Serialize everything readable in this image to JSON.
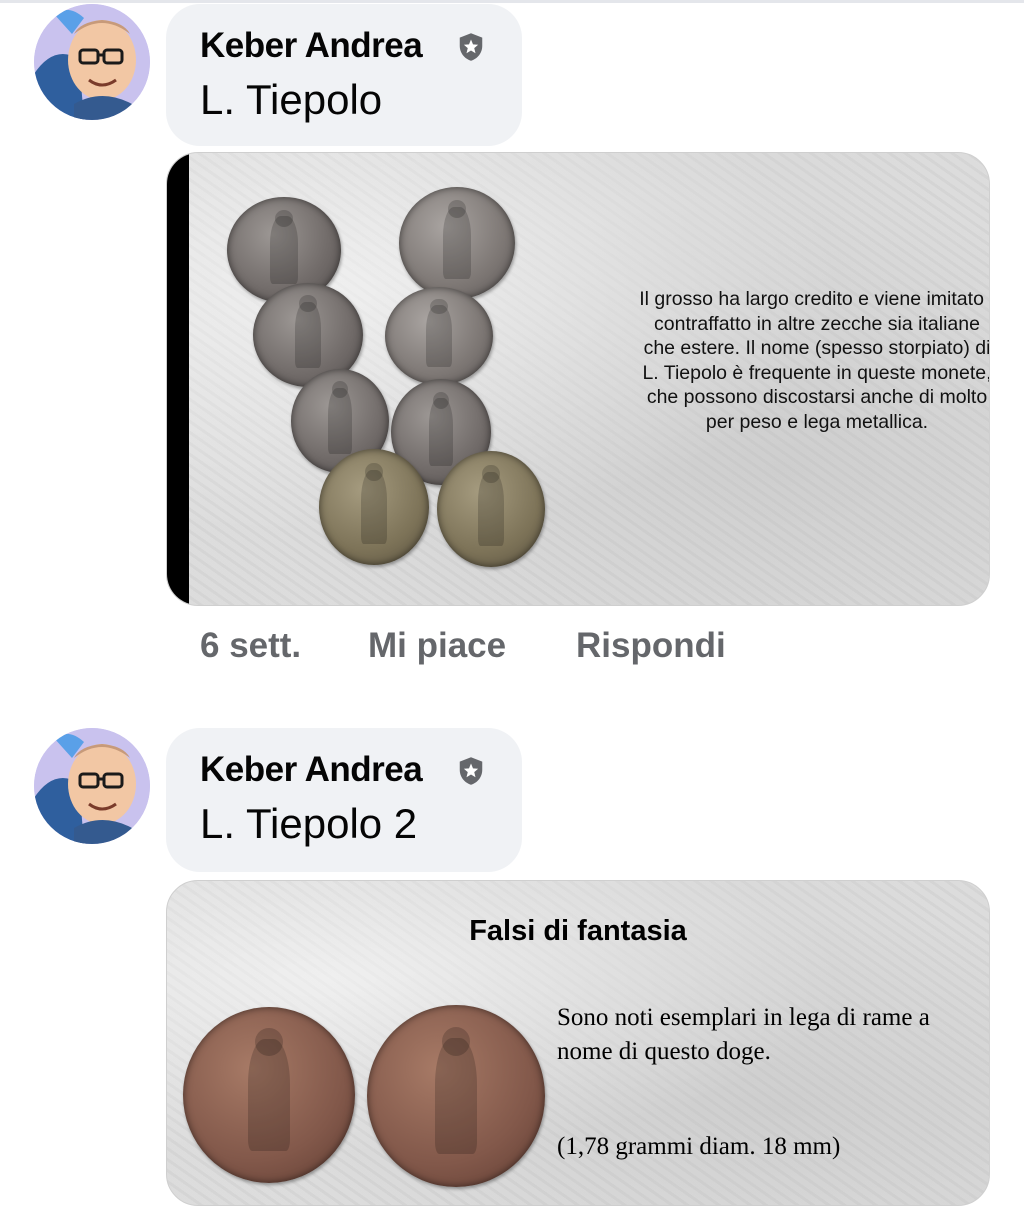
{
  "comments": [
    {
      "author": "Keber Andrea",
      "text": "L. Tiepolo",
      "attachment": {
        "description": "Il grosso ha largo credito e viene imitato / contraffatto in altre zecche sia italiane che estere. Il nome (spesso storpiato) di L. Tiepolo è frequente in queste monete, che possono discostarsi anche di molto per peso e lega metallica."
      },
      "actions": {
        "time": "6 sett.",
        "like": "Mi piace",
        "reply": "Rispondi"
      }
    },
    {
      "author": "Keber Andrea",
      "text": "L. Tiepolo 2",
      "attachment": {
        "title": "Falsi di fantasia",
        "description": "Sono noti esemplari in lega di rame a nome di questo doge.",
        "note": "(1,78 grammi diam. 18 mm)"
      }
    }
  ],
  "colors": {
    "bubble": "#f0f2f5",
    "action_text": "#65676b",
    "avatar_bg": "#c9c2ee"
  },
  "icons": {
    "badge": "shield-star-icon",
    "avatar": "cartoon-avatar"
  }
}
